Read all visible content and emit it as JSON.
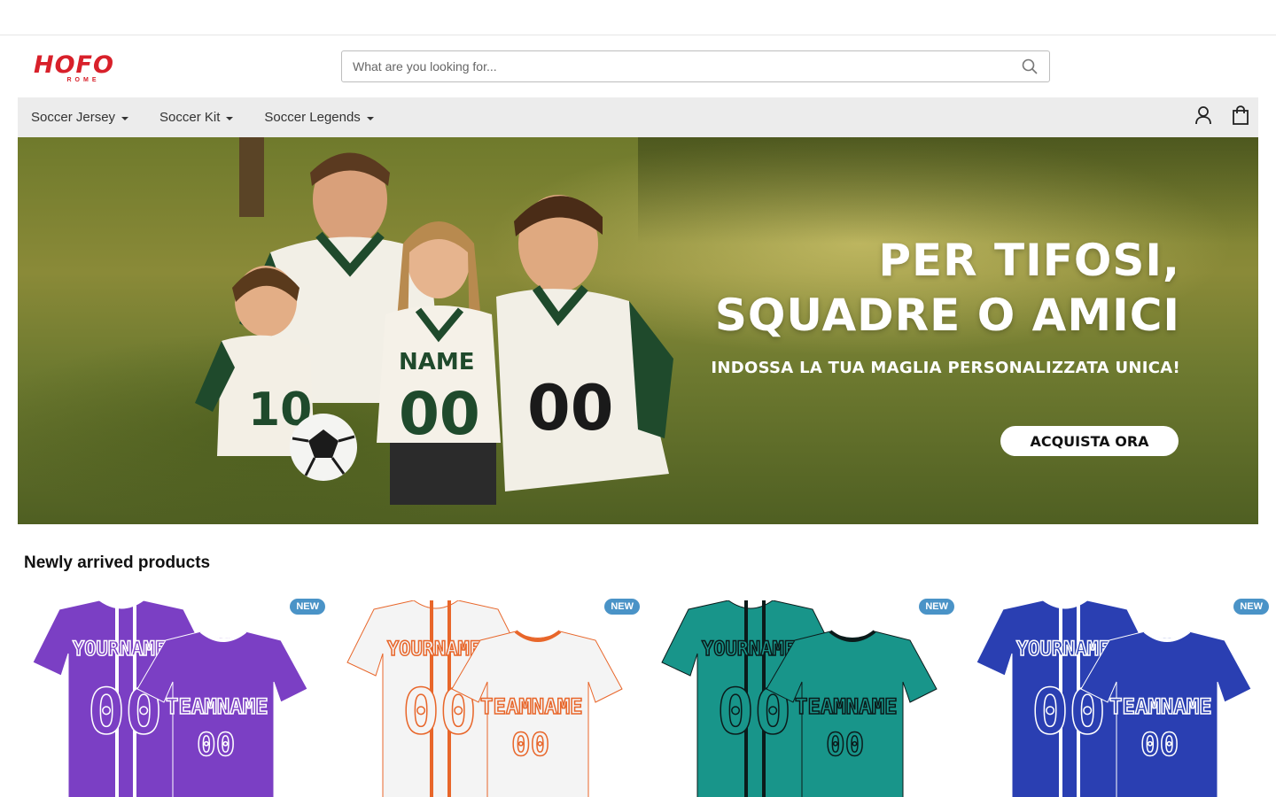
{
  "brand": {
    "name": "HOFO",
    "sub": "ROME",
    "color": "#d8202a"
  },
  "search": {
    "placeholder": "What are you looking for...",
    "icon": "search-icon"
  },
  "nav": {
    "items": [
      {
        "label": "Soccer Jersey"
      },
      {
        "label": "Soccer Kit"
      },
      {
        "label": "Soccer Legends"
      }
    ],
    "account_icon": "user-icon",
    "cart_icon": "shopping-bag-icon"
  },
  "hero": {
    "line1": "PER TIFOSI,",
    "line2": "SQUADRE O AMICI",
    "sub": "INDOSSA LA TUA MAGLIA PERSONALIZZATA UNICA!",
    "button": "ACQUISTA ORA",
    "jersey_texts": {
      "name": "NAME",
      "number": "00",
      "kid_number": "10"
    }
  },
  "section": {
    "title": "Newly arrived products"
  },
  "products": [
    {
      "badge": "NEW",
      "color": "#7b3fc4",
      "accent": "#ffffff",
      "name_text": "YOURNAME",
      "team_text": "TEAMNAME",
      "number": "00"
    },
    {
      "badge": "NEW",
      "color": "#f4f4f4",
      "accent": "#e8662a",
      "name_text": "YOURNAME",
      "team_text": "TEAMNAME",
      "number": "00"
    },
    {
      "badge": "NEW",
      "color": "#18958a",
      "accent": "#0b1a1a",
      "name_text": "YOURNAME",
      "team_text": "TEAMNAME",
      "number": "00"
    },
    {
      "badge": "NEW",
      "color": "#2a3fb2",
      "accent": "#ffffff",
      "name_text": "YOURNAME",
      "team_text": "TEAMNAME",
      "number": "00"
    }
  ]
}
